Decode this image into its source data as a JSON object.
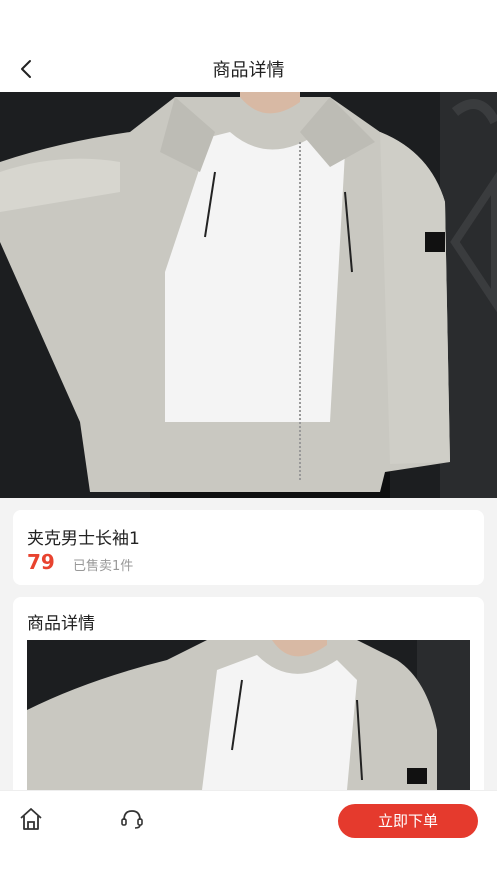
{
  "header": {
    "title": "商品详情",
    "back_icon": "chevron-left-icon"
  },
  "product": {
    "name": "夹克男士长袖1",
    "price": "79",
    "sold": "已售卖1件",
    "price_color": "#e8432f"
  },
  "detail": {
    "section_title": "商品详情"
  },
  "bottom": {
    "home_icon": "home-icon",
    "service_icon": "headset-icon",
    "order_label": "立即下单",
    "order_color": "#e53a2d"
  }
}
